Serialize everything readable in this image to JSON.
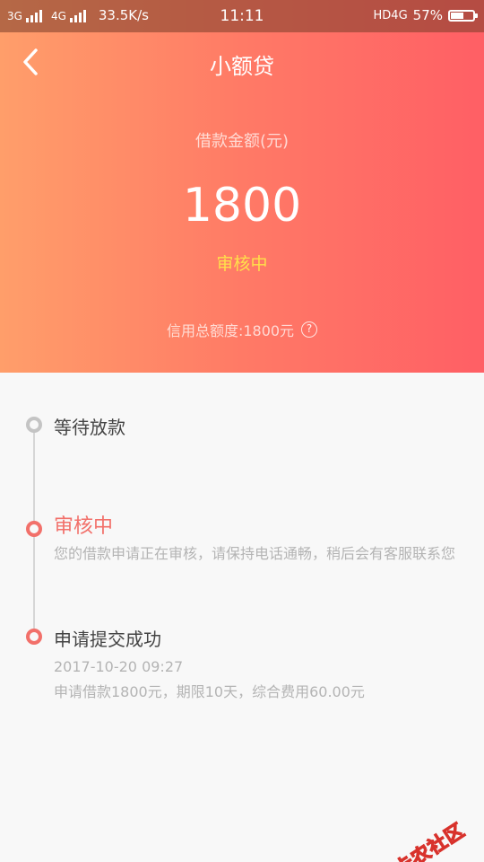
{
  "status_bar": {
    "net1": "3G",
    "net2": "4G",
    "speed": "33.5K/s",
    "time": "11:11",
    "hd_label": "HD",
    "net3": "4G",
    "battery_percent": "57%",
    "battery_level": 0.57
  },
  "nav": {
    "back_icon": "chevron-left-icon",
    "title": "小额贷"
  },
  "loan": {
    "amount_label": "借款金额(元)",
    "amount_value": "1800",
    "status": "审核中",
    "credit_limit": "信用总额度:1800元",
    "help_icon": "question-circle-icon",
    "help_glyph": "?"
  },
  "timeline": {
    "steps": [
      {
        "title": "等待放款",
        "state": "pending",
        "lines": []
      },
      {
        "title": "审核中",
        "state": "active",
        "lines": [
          "您的借款申请正在审核，请保持电话通畅，稍后会有客服联系您"
        ]
      },
      {
        "title": "申请提交成功",
        "state": "done",
        "lines": [
          "2017-10-20 09:27",
          "申请借款1800元，期限10天，综合费用60.00元"
        ]
      }
    ]
  },
  "watermark": {
    "text": "卡农社区",
    "icon": "kanong-logo-icon"
  },
  "colors": {
    "header_gradient_start": "#ff9e6a",
    "header_gradient_end": "#ff5f65",
    "status_yellow": "#ffe14a",
    "accent_red": "#f2706a",
    "inactive_gray": "#c4c4c4"
  }
}
